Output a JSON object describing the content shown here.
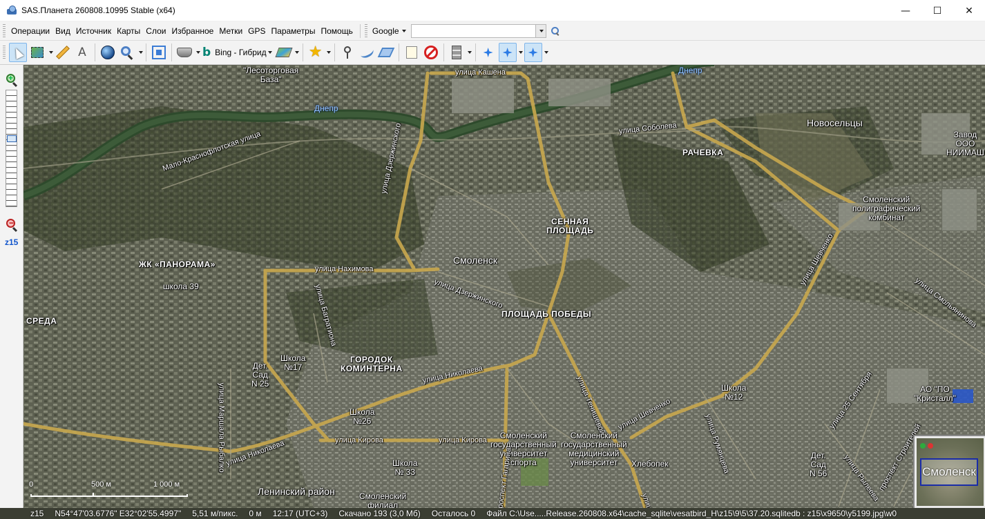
{
  "window": {
    "title": "SAS.Планета 260808.10995 Stable (x64)",
    "controls": {
      "minimize": "—",
      "maximize": "☐",
      "close": "✕"
    }
  },
  "menu": {
    "items": [
      "Операции",
      "Вид",
      "Источник",
      "Карты",
      "Слои",
      "Избранное",
      "Метки",
      "GPS",
      "Параметры",
      "Помощь"
    ],
    "search_engine": "Google",
    "search_value": ""
  },
  "toolbar": {
    "map_source_label": "Bing - Гибрид",
    "icons": [
      "cursor-icon",
      "select-area-icon",
      "ruler-icon",
      "compass-icon",
      "globe-icon",
      "zoom-icon",
      "fullscreen-icon",
      "satellite-icon",
      "bing-icon",
      "layers-icon",
      "star-icon",
      "placemark-icon",
      "path-icon",
      "polygon-icon",
      "note-icon",
      "no-entry-icon",
      "database-icon",
      "gps-icon",
      "gps-track-icon",
      "gps-center-icon"
    ]
  },
  "zoom_panel": {
    "level": "z15"
  },
  "map": {
    "labels": {
      "lesotorgovaya": "\"Лесоторговая\nБаза\"",
      "dnepr1": "Днепр",
      "dnepr2": "Днепр",
      "kashena": "улица Кашена",
      "soboleva": "улица Соболева",
      "novoseltsy": "Новосельцы",
      "zavod": "Завод\nООО\nНИИМАШ",
      "rachevka": "РАЧЕВКА",
      "malo_kr": "Мало-Краснофлотская улица",
      "dzerzhinskogo_v": "улица Дзержинского",
      "dzerzhinskogo_h": "улица Дзержинского",
      "poligraf": "Смоленский\nполиграфический\nкомбинат",
      "sennaya": "СЕННАЯ\nПЛОЩАДЬ",
      "smolensk": "Смоленск",
      "panorama": "ЖК «ПАНОРАМА»",
      "nakhimova": "улица Нахимова",
      "shkola39": "школа 39",
      "bagrationa": "улица Багратиона",
      "pobedy": "ПЛОЩАДЬ ПОБЕДЫ",
      "shevchenko_v": "улица Шевченко",
      "smolyaninova": "улица Смольянинова",
      "sreda": "СРЕДА",
      "det_sad25": "Дет.\nСад\nN 25",
      "shkola17": "Школа\n№17",
      "kominterna": "ГОРОДОК\nКОМИНТЕРНА",
      "nikolaeva1": "улица Николаева",
      "nikolaeva2": "улица Николаева",
      "shkola12": "Школа\n№12",
      "kristall": "АО \"ПО\n\"Кристалл\"",
      "25sent": "улица 25 Сентября",
      "marshala": "улица Маршала Рыбалко",
      "shkola26": "Школа\n№26",
      "kirova1": "улица Кирова",
      "kirova2": "улица Кирова",
      "tenisheva": "улица Тенишевой",
      "shevchenko_h": "улица Шевченко",
      "sport_univ": "Смоленский\nгосударственный\nуниверситет\nспорта",
      "med_univ": "Смоленский\nгосударственный\nмедицинский\nуниверситет",
      "rumyantseva": "улица Румянцева",
      "ryleeva": "улица Рылеева",
      "detsad56": "Дет.\nСад\nN 56",
      "stroit": "проспект Строителей",
      "gagarina": "проспект Гагарина",
      "khlebopek": "Хлебопек",
      "shkola33": "Школа\n№ 33",
      "leninsky": "Ленинский район",
      "filial": "Смоленский\nфилиал",
      "ulitsa_short": "улица"
    },
    "scale": {
      "zero": "0",
      "mid": "500 м",
      "end": "1 000 м"
    },
    "overview_label": "Смоленск"
  },
  "status": {
    "zoom": "z15",
    "coords": "N54°47'03.6776\" E32°02'55.4997\"",
    "resolution": "5,51 м/пикс.",
    "distance": "0 м",
    "time": "12:17 (UTC+3)",
    "downloaded": "Скачано 193 (3,0 Мб)",
    "remaining": "Осталось 0",
    "file": "Файл C:\\Use.....Release.260808.x64\\cache_sqlite\\vesatbird_H\\z15\\9\\5\\37.20.sqlitedb : z15\\x9650\\y5199.jpg\\w0"
  }
}
